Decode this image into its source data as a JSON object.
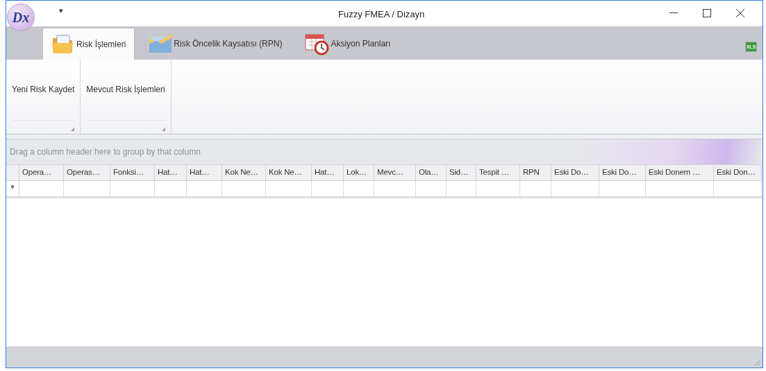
{
  "window": {
    "title": "Fuzzy FMEA / Dizayn",
    "logo_text": "Dx",
    "quick_access": "▾"
  },
  "tabs": [
    {
      "label": "Risk İşlemleri",
      "selected": true,
      "kind": "folder"
    },
    {
      "label": "Risk Öncelik Kaysatısı (RPN)",
      "selected": false,
      "kind": "chart"
    },
    {
      "label": "Aksiyon Planları",
      "selected": false,
      "kind": "calendar"
    }
  ],
  "export_icon_label": "XLS",
  "ribbon_groups": [
    {
      "label": "Yeni Risk Kaydet"
    },
    {
      "label": "Mevcut Risk İşlemleri"
    }
  ],
  "grid": {
    "group_panel_hint": "Drag a column header here to group by that column",
    "new_row_marker": "📍",
    "columns": [
      "Opera…",
      "Operas…",
      "Fonksi…",
      "Hat…",
      "Hat…",
      "Kok Ne…",
      "Kok Ne…",
      "Hat…",
      "Lok…",
      "Mevc…",
      "Ola…",
      "Sid…",
      "Tespit …",
      "RPN",
      "Eski Do…",
      "Eski Do…",
      "Eski Donem …",
      "Eski Don…"
    ]
  }
}
